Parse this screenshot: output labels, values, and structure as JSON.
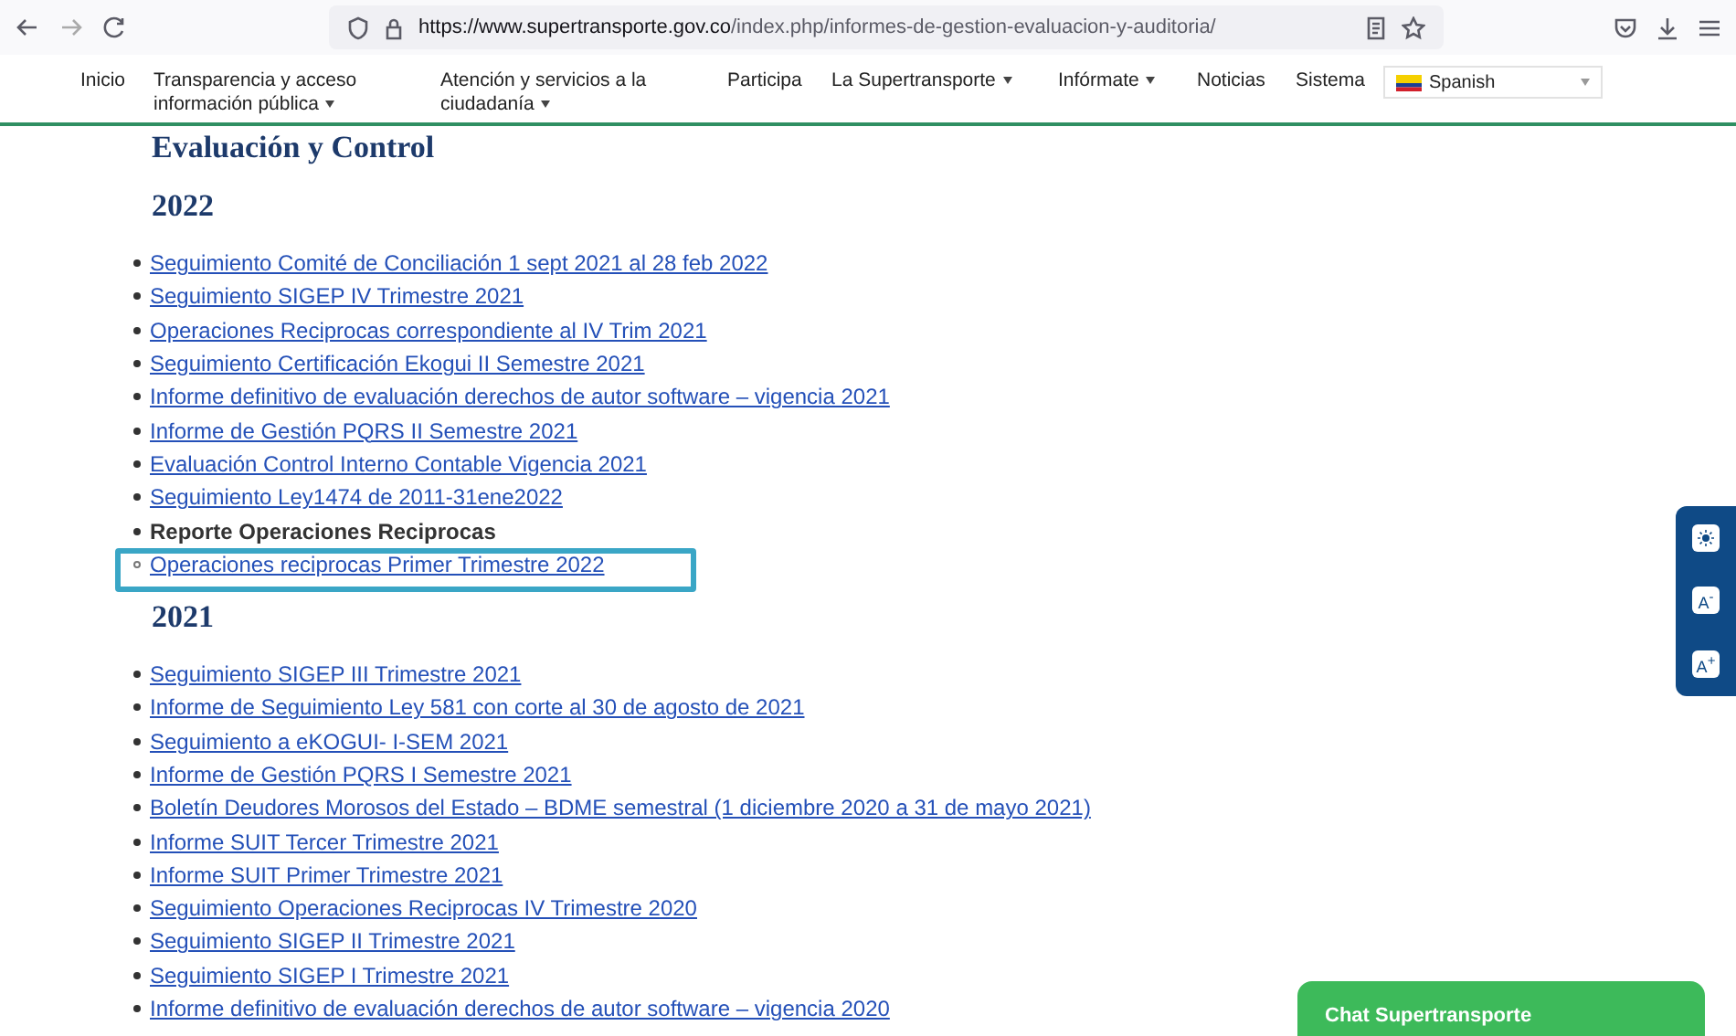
{
  "browser": {
    "url_host": "https://www.supertransporte.gov.co",
    "url_path": "/index.php/informes-de-gestion-evaluacion-y-auditoria/"
  },
  "nav": [
    {
      "label": "Inicio",
      "has_menu": false
    },
    {
      "label": "Transparencia y acceso información pública",
      "has_menu": true
    },
    {
      "label": "Atención y servicios a la ciudadanía",
      "has_menu": true
    },
    {
      "label": "Participa",
      "has_menu": false
    },
    {
      "label": "La Supertransporte",
      "has_menu": true
    },
    {
      "label": "Infórmate",
      "has_menu": true
    },
    {
      "label": "Noticias",
      "has_menu": false
    },
    {
      "label": "Sistema",
      "has_menu": false
    }
  ],
  "language_select": {
    "value": "Spanish"
  },
  "page_title": "Evaluación y Control",
  "sections": [
    {
      "year": "2022",
      "items": [
        {
          "kind": "link",
          "text": "Seguimiento Comité de Conciliación 1 sept 2021 al 28 feb 2022"
        },
        {
          "kind": "link",
          "text": "Seguimiento SIGEP IV Trimestre 2021"
        },
        {
          "kind": "link",
          "text": "Operaciones Reciprocas correspondiente al IV Trim 2021"
        },
        {
          "kind": "link",
          "text": "Seguimiento Certificación Ekogui II Semestre 2021"
        },
        {
          "kind": "link",
          "text": "Informe definitivo de evaluación derechos de autor software – vigencia 2021"
        },
        {
          "kind": "link",
          "text": "Informe de Gestión PQRS II Semestre 2021"
        },
        {
          "kind": "link",
          "text": "Evaluación Control Interno Contable Vigencia 2021"
        },
        {
          "kind": "link",
          "text": "Seguimiento Ley1474 de 2011-31ene2022"
        },
        {
          "kind": "label",
          "text": "Reporte Operaciones Reciprocas",
          "children": [
            {
              "kind": "link",
              "text": "Operaciones reciprocas Primer Trimestre 2022",
              "highlighted": true
            }
          ]
        }
      ]
    },
    {
      "year": "2021",
      "items": [
        {
          "kind": "link",
          "text": "Seguimiento SIGEP III Trimestre 2021"
        },
        {
          "kind": "link",
          "text": "Informe de Seguimiento Ley 581 con corte al 30 de agosto de 2021"
        },
        {
          "kind": "link",
          "text": "Seguimiento a eKOGUI- I-SEM 2021"
        },
        {
          "kind": "link",
          "text": "Informe de Gestión PQRS I Semestre 2021"
        },
        {
          "kind": "link",
          "text": "Boletín Deudores Morosos del Estado – BDME semestral (1 diciembre 2020 a 31 de mayo 2021)"
        },
        {
          "kind": "link",
          "text": "Informe SUIT Tercer Trimestre 2021"
        },
        {
          "kind": "link",
          "text": "Informe SUIT Primer Trimestre 2021"
        },
        {
          "kind": "link",
          "text": "Seguimiento Operaciones Reciprocas IV Trimestre 2020"
        },
        {
          "kind": "link",
          "text": "Seguimiento SIGEP II Trimestre 2021"
        },
        {
          "kind": "link",
          "text": "Seguimiento SIGEP I Trimestre 2021"
        },
        {
          "kind": "link",
          "text": "Informe definitivo de evaluación derechos de autor software – vigencia 2020"
        }
      ]
    }
  ],
  "accessibility_tools": [
    {
      "kind": "contrast"
    },
    {
      "kind": "text",
      "label": "A$^{-}$"
    },
    {
      "kind": "text",
      "label": "A$^{+}$"
    }
  ],
  "chat": {
    "title": "Chat Supertransporte"
  }
}
